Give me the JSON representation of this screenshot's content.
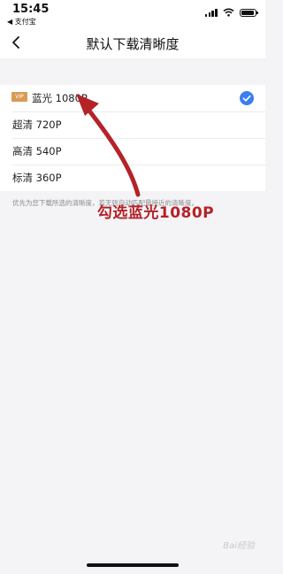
{
  "status_bar": {
    "time": "15:45",
    "back_app": "◀ 支付宝"
  },
  "nav": {
    "title": "默认下载清晰度",
    "back_icon": "chevron-left-icon"
  },
  "options": [
    {
      "label": "蓝光 1080P",
      "badge": "VIP",
      "selected": true
    },
    {
      "label": "超清 720P",
      "selected": false
    },
    {
      "label": "高清 540P",
      "selected": false
    },
    {
      "label": "标清 360P",
      "selected": false
    }
  ],
  "hint": "优先为您下载所选的清晰度，若无则自动匹配最接近的清晰度。",
  "annotation": {
    "text": "勾选蓝光1080P",
    "color": "#b32328"
  },
  "watermark": "Bai经验",
  "colors": {
    "check": "#3b7ff0",
    "vip_badge": "#d99a55"
  }
}
